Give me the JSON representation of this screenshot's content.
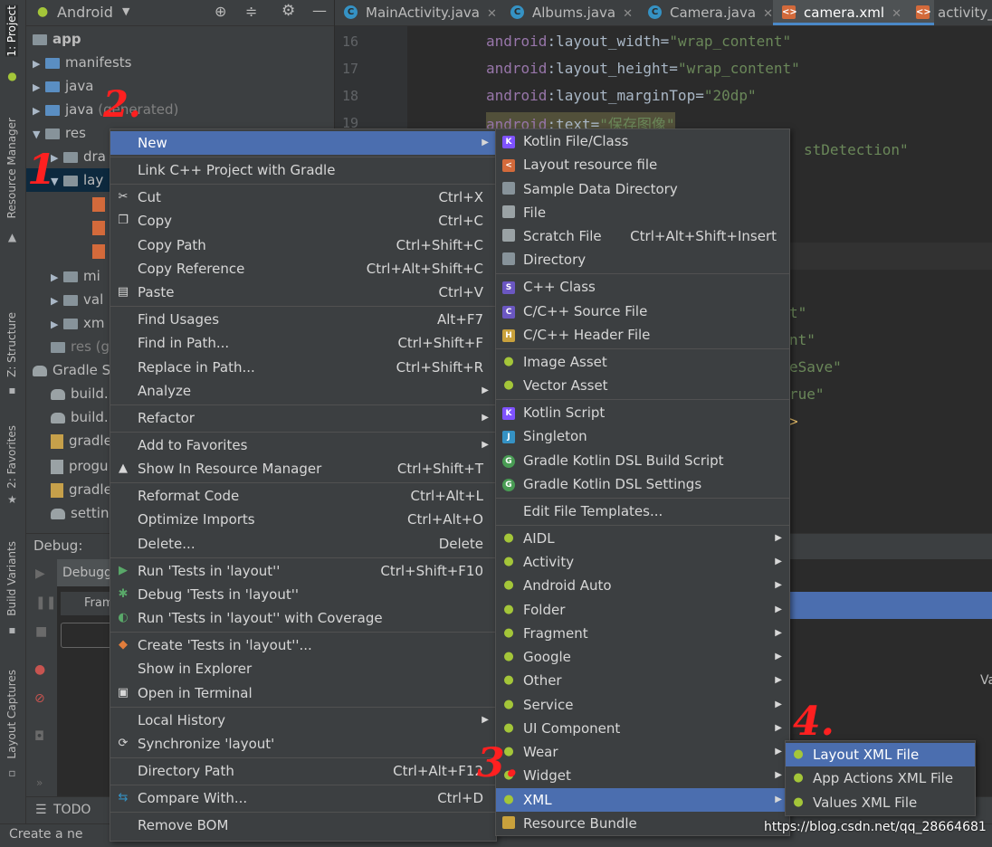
{
  "left_stripe": {
    "project": "1: Project",
    "resource_manager": "Resource Manager",
    "structure": "Z: Structure",
    "favorites": "2: Favorites",
    "build_variants": "Build Variants",
    "layout_captures": "Layout Captures"
  },
  "project_panel": {
    "view_mode": "Android",
    "tree": {
      "app": "app",
      "manifests": "manifests",
      "java": "java",
      "java_generated": "java",
      "java_generated_suffix": "(generated)",
      "res": "res",
      "drawable": "dra",
      "layout": "lay",
      "mipmap": "mi",
      "values": "val",
      "xml": "xm",
      "res_generated": "res (g",
      "gradle_scripts": "Gradle Sc",
      "build1": "build.",
      "build2": "build.",
      "gradle1": "gradle",
      "proguard": "progu",
      "gradle2": "gradle",
      "settings": "settin"
    }
  },
  "tabs": [
    {
      "label": "MainActivity.java",
      "icon": "C"
    },
    {
      "label": "Albums.java",
      "icon": "C"
    },
    {
      "label": "Camera.java",
      "icon": "C"
    },
    {
      "label": "camera.xml",
      "icon": "xml"
    },
    {
      "label": "activity_r",
      "icon": "xml"
    }
  ],
  "editor": {
    "line_numbers": [
      "16",
      "17",
      "18",
      "19"
    ],
    "lines": [
      {
        "attr": "android",
        "name": ":layout_width",
        "val": "\"wrap_content\""
      },
      {
        "attr": "android",
        "name": ":layout_height",
        "val": "\"wrap_content\""
      },
      {
        "attr": "android",
        "name": ":layout_marginTop",
        "val": "\"20dp\""
      },
      {
        "attr": "android",
        "name": ":text",
        "val": "\"保存图像\""
      }
    ],
    "fragments": [
      "stDetection\"",
      "t\"",
      "nt\"",
      "eSave\"",
      "rue\"",
      ">"
    ]
  },
  "debug": {
    "title": "Debug:",
    "tab": "Debugg",
    "frames": "Fram",
    "right_text": "Va"
  },
  "bottom": {
    "todo": "TODO",
    "status": "Create a ne"
  },
  "context_menu": {
    "items": [
      {
        "label": "New",
        "shortcut": "",
        "submenu": true
      },
      {
        "label": "Link C++ Project with Gradle",
        "shortcut": ""
      },
      {
        "label": "Cut",
        "shortcut": "Ctrl+X"
      },
      {
        "label": "Copy",
        "shortcut": "Ctrl+C"
      },
      {
        "label": "Copy Path",
        "shortcut": "Ctrl+Shift+C"
      },
      {
        "label": "Copy Reference",
        "shortcut": "Ctrl+Alt+Shift+C"
      },
      {
        "label": "Paste",
        "shortcut": "Ctrl+V"
      },
      {
        "label": "Find Usages",
        "shortcut": "Alt+F7"
      },
      {
        "label": "Find in Path...",
        "shortcut": "Ctrl+Shift+F"
      },
      {
        "label": "Replace in Path...",
        "shortcut": "Ctrl+Shift+R"
      },
      {
        "label": "Analyze",
        "shortcut": "",
        "submenu": true
      },
      {
        "label": "Refactor",
        "shortcut": "",
        "submenu": true
      },
      {
        "label": "Add to Favorites",
        "shortcut": "",
        "submenu": true
      },
      {
        "label": "Show In Resource Manager",
        "shortcut": "Ctrl+Shift+T"
      },
      {
        "label": "Reformat Code",
        "shortcut": "Ctrl+Alt+L"
      },
      {
        "label": "Optimize Imports",
        "shortcut": "Ctrl+Alt+O"
      },
      {
        "label": "Delete...",
        "shortcut": "Delete"
      },
      {
        "label": "Run 'Tests in 'layout''",
        "shortcut": "Ctrl+Shift+F10"
      },
      {
        "label": "Debug 'Tests in 'layout''",
        "shortcut": ""
      },
      {
        "label": "Run 'Tests in 'layout'' with Coverage",
        "shortcut": ""
      },
      {
        "label": "Create 'Tests in 'layout''...",
        "shortcut": ""
      },
      {
        "label": "Show in Explorer",
        "shortcut": ""
      },
      {
        "label": "Open in Terminal",
        "shortcut": ""
      },
      {
        "label": "Local History",
        "shortcut": "",
        "submenu": true
      },
      {
        "label": "Synchronize 'layout'",
        "shortcut": ""
      },
      {
        "label": "Directory Path",
        "shortcut": "Ctrl+Alt+F12"
      },
      {
        "label": "Compare With...",
        "shortcut": "Ctrl+D"
      },
      {
        "label": "Remove BOM",
        "shortcut": ""
      }
    ]
  },
  "new_menu": {
    "items": [
      {
        "label": "Kotlin File/Class"
      },
      {
        "label": "Layout resource file"
      },
      {
        "label": "Sample Data Directory"
      },
      {
        "label": "File"
      },
      {
        "label": "Scratch File",
        "shortcut": "Ctrl+Alt+Shift+Insert"
      },
      {
        "label": "Directory"
      },
      {
        "label": "C++ Class"
      },
      {
        "label": "C/C++ Source File"
      },
      {
        "label": "C/C++ Header File"
      },
      {
        "label": "Image Asset"
      },
      {
        "label": "Vector Asset"
      },
      {
        "label": "Kotlin Script"
      },
      {
        "label": "Singleton"
      },
      {
        "label": "Gradle Kotlin DSL Build Script"
      },
      {
        "label": "Gradle Kotlin DSL Settings"
      },
      {
        "label": "Edit File Templates..."
      },
      {
        "label": "AIDL"
      },
      {
        "label": "Activity"
      },
      {
        "label": "Android Auto"
      },
      {
        "label": "Folder"
      },
      {
        "label": "Fragment"
      },
      {
        "label": "Google"
      },
      {
        "label": "Other"
      },
      {
        "label": "Service"
      },
      {
        "label": "UI Component"
      },
      {
        "label": "Wear"
      },
      {
        "label": "Widget"
      },
      {
        "label": "XML"
      },
      {
        "label": "Resource Bundle"
      }
    ]
  },
  "xml_menu": {
    "items": [
      {
        "label": "Layout XML File"
      },
      {
        "label": "App Actions XML File"
      },
      {
        "label": "Values XML File"
      }
    ]
  },
  "annotations": [
    "1",
    "2.",
    "3.",
    "4."
  ],
  "watermark": "https://blog.csdn.net/qq_28664681",
  "colors": {
    "highlight": "#4b6eaf",
    "menu_bg": "#3c3f41",
    "editor_bg": "#2b2b2b",
    "annotation": "#ff2020",
    "android_green": "#a4c639"
  }
}
